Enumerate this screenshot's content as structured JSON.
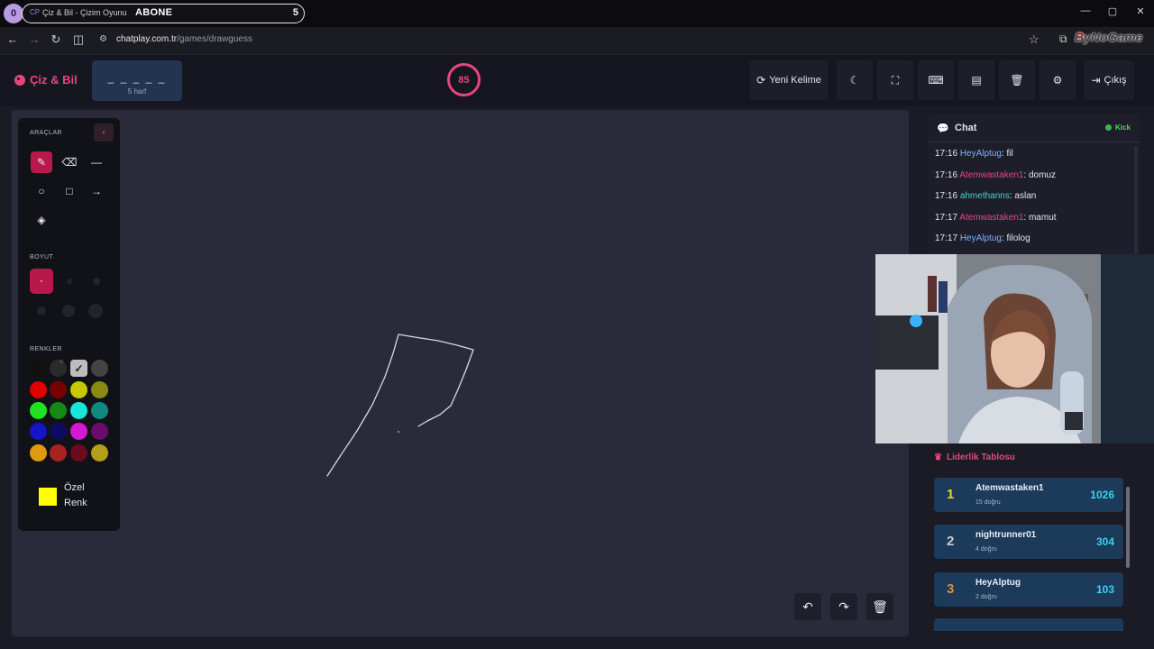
{
  "browser": {
    "profile_initial": "0",
    "tab": {
      "favicon": "CP",
      "title": "Çiz & Bil - Çizim Oyunu",
      "overlay_text": "ABONE",
      "overlay_count": "5"
    },
    "url_domain": "chatplay.com.tr",
    "url_path": "/games/drawguess",
    "watermark": "ByNoGame"
  },
  "header": {
    "logo": "Çiz & Bil",
    "word_hint": "_ _ _ _ _",
    "letter_count": "5 harf",
    "timer": "85",
    "buttons": {
      "new_word": "Yeni Kelime",
      "exit": "Çıkış"
    }
  },
  "toolbox": {
    "tools_heading": "ARAÇLAR",
    "size_heading": "BOYUT",
    "colors_heading": "RENKLER",
    "custom_color_label_1": "Özel",
    "custom_color_label_2": "Renk",
    "colors": [
      "#111111",
      "#2a2a2a",
      "#bdbdbd",
      "#444444",
      "#e00000",
      "#7a0000",
      "#c8c800",
      "#8a8a10",
      "#22e022",
      "#138a13",
      "#16e6d8",
      "#0f8a80",
      "#1414c8",
      "#0c0c66",
      "#d418d4",
      "#6a0d6a",
      "#e09a10",
      "#a82222",
      "#6a0a1e",
      "#b4a018"
    ],
    "custom_color": "#ffff00",
    "accent": "#b8184a"
  },
  "chat": {
    "title": "Chat",
    "status": "Kick",
    "messages": [
      {
        "time": "17:16",
        "user": "HeyAlptug",
        "user_color": "#7fb2ff",
        "text": ": fil"
      },
      {
        "time": "17:16",
        "user": "Atemwastaken1",
        "user_color": "#e8457c",
        "text": ": domuz"
      },
      {
        "time": "17:16",
        "user": "ahmethanns",
        "user_color": "#3fd6c8",
        "text": ": aslan"
      },
      {
        "time": "17:17",
        "user": "Atemwastaken1",
        "user_color": "#e8457c",
        "text": ": mamut"
      },
      {
        "time": "17:17",
        "user": "HeyAlptug",
        "user_color": "#7fb2ff",
        "text": ": filolog"
      }
    ]
  },
  "leaderboard": {
    "title": "Liderlik Tablosu",
    "rows": [
      {
        "rank": "1",
        "name": "Atemwastaken1",
        "sub": "15 doğru",
        "score": "1026",
        "rank_color": "#f5d020"
      },
      {
        "rank": "2",
        "name": "nightrunner01",
        "sub": "4 doğru",
        "score": "304",
        "rank_color": "#c9ced8"
      },
      {
        "rank": "3",
        "name": "HeyAlptug",
        "sub": "2 doğru",
        "score": "103",
        "rank_color": "#e08a3a"
      }
    ]
  },
  "colors": {
    "accent": "#e8457c",
    "background": "#1a1b24",
    "canvas": "#2a2a3a"
  }
}
